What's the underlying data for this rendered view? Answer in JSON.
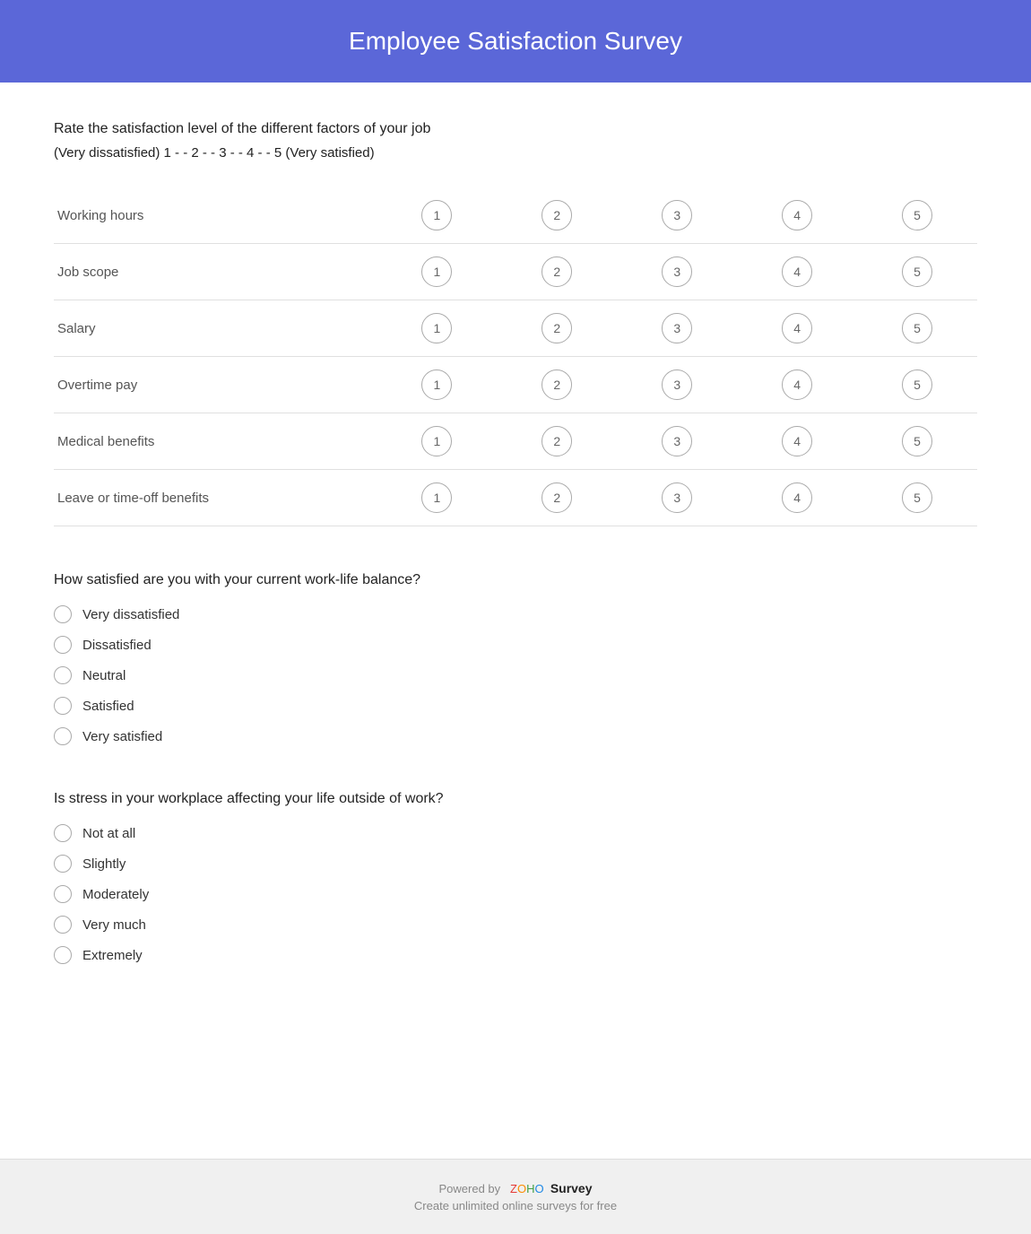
{
  "header": {
    "title": "Employee Satisfaction Survey"
  },
  "section1": {
    "question": "Rate the satisfaction level of the different factors of your job",
    "scale_hint": "(Very dissatisfied) 1 - - 2 - - 3 - - 4 - - 5 (Very satisfied)",
    "rows": [
      {
        "label": "Working hours"
      },
      {
        "label": "Job scope"
      },
      {
        "label": "Salary"
      },
      {
        "label": "Overtime pay"
      },
      {
        "label": "Medical benefits"
      },
      {
        "label": "Leave or time-off benefits"
      }
    ],
    "scale": [
      "1",
      "2",
      "3",
      "4",
      "5"
    ]
  },
  "section2": {
    "question": "How satisfied are you with your current work-life balance?",
    "options": [
      "Very dissatisfied",
      "Dissatisfied",
      "Neutral",
      "Satisfied",
      "Very satisfied"
    ]
  },
  "section3": {
    "question": "Is stress in your workplace affecting your life outside of work?",
    "options": [
      "Not at all",
      "Slightly",
      "Moderately",
      "Very much",
      "Extremely"
    ]
  },
  "footer": {
    "powered_by": "Powered by",
    "brand_z": "Z",
    "brand_o": "O",
    "brand_h": "H",
    "brand_o2": "O",
    "brand_survey": "Survey",
    "sub_text": "Create unlimited online surveys for free"
  }
}
